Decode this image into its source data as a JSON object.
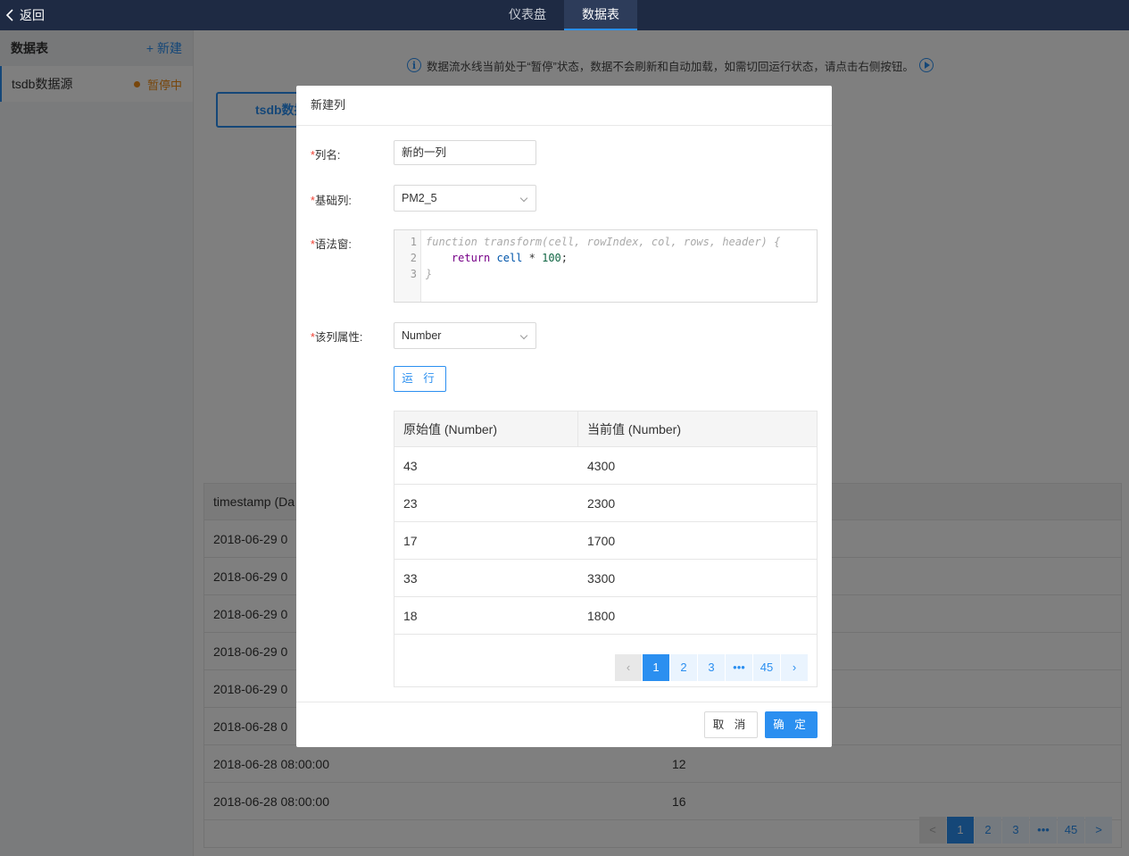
{
  "topbar": {
    "back_label": "返回",
    "tabs": [
      {
        "label": "仪表盘",
        "active": false
      },
      {
        "label": "数据表",
        "active": true
      }
    ]
  },
  "sidebar": {
    "title": "数据表",
    "new_label": "+ 新建",
    "items": [
      {
        "label": "tsdb数据源",
        "status": "暂停中"
      }
    ]
  },
  "notice": "数据流水线当前处于“暂停”状态，数据不会刷新和自动加载，如需切回运行状态，请点击右侧按钮。",
  "source_button": "tsdb数据",
  "bg_table": {
    "header": [
      "timestamp (Da",
      ""
    ],
    "rows": [
      [
        "2018-06-29 0",
        ""
      ],
      [
        "2018-06-29 0",
        ""
      ],
      [
        "2018-06-29 0",
        ""
      ],
      [
        "2018-06-29 0",
        ""
      ],
      [
        "2018-06-29 0",
        ""
      ],
      [
        "2018-06-28 0",
        ""
      ],
      [
        "2018-06-28 08:00:00",
        "12"
      ],
      [
        "2018-06-28 08:00:00",
        "16"
      ]
    ],
    "pagination": {
      "prev": "<",
      "pages": [
        "1",
        "2",
        "3"
      ],
      "ellipsis": "•••",
      "last": "45",
      "next": ">",
      "current": "1"
    }
  },
  "modal": {
    "title": "新建列",
    "fields": {
      "name_label": "列名:",
      "name_value": "新的一列",
      "base_label": "基础列:",
      "base_value": "PM2_5",
      "syntax_label": "语法窗:",
      "type_label": "该列属性:",
      "type_value": "Number"
    },
    "code_lines": [
      "1",
      "2",
      "3"
    ],
    "code": {
      "line1": "function transform(cell, rowIndex, col, rows, header) {",
      "line2_kw": "return",
      "line2_var": "cell",
      "line2_op": " * ",
      "line2_num": "100",
      "line2_end": ";",
      "line3": "}"
    },
    "run_label": "运 行",
    "result_table": {
      "headers": [
        "原始值 (Number)",
        "当前值 (Number)"
      ],
      "rows": [
        [
          "43",
          "4300"
        ],
        [
          "23",
          "2300"
        ],
        [
          "17",
          "1700"
        ],
        [
          "33",
          "3300"
        ],
        [
          "18",
          "1800"
        ]
      ],
      "pagination": {
        "prev": "‹",
        "pages": [
          "1",
          "2",
          "3"
        ],
        "ellipsis": "•••",
        "last": "45",
        "next": "›",
        "current": "1"
      }
    },
    "cancel_label": "取 消",
    "ok_label": "确 定"
  },
  "colors": {
    "topbar": "#1e2a43",
    "accent": "#2b8ff0",
    "paused": "#f08c16",
    "required": "#f04134"
  }
}
